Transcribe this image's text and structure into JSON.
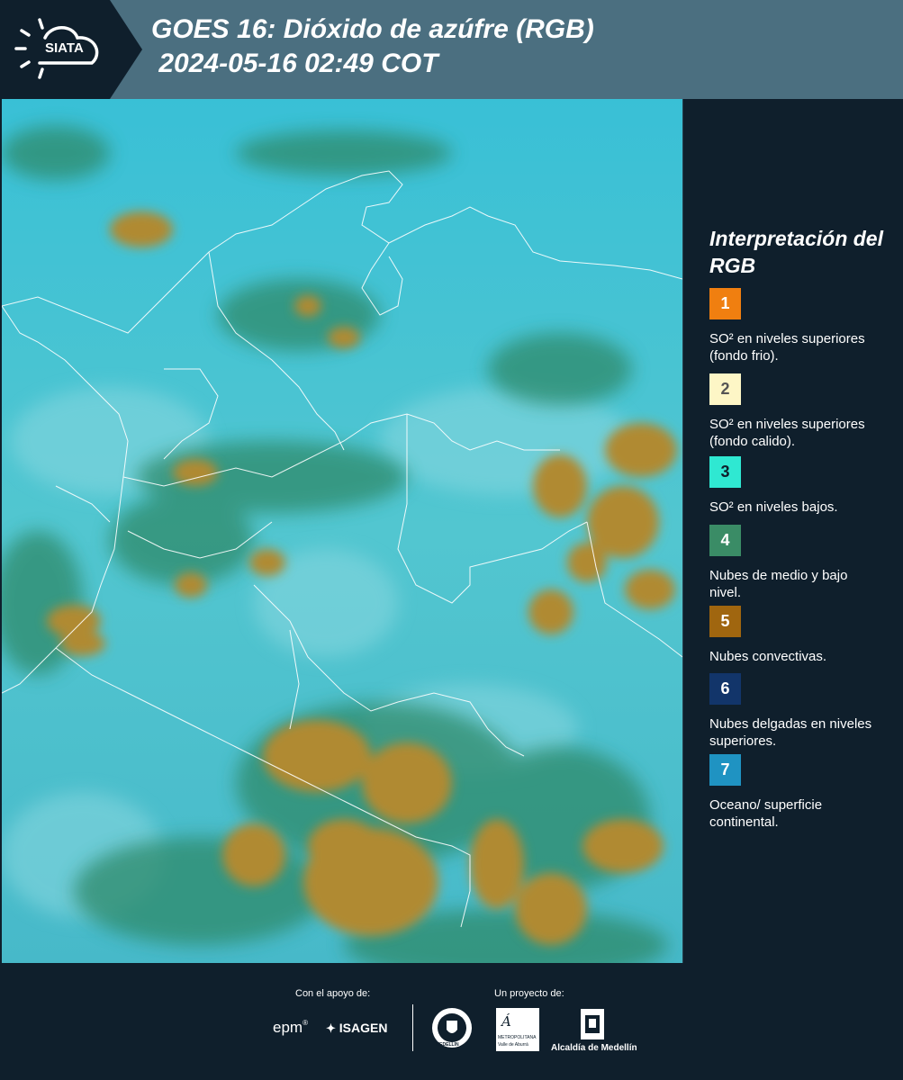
{
  "header": {
    "logo_text": "SIATA",
    "title_line1": "GOES 16: Dióxido de azúfre (RGB)",
    "title_line2": " 2024-05-16 02:49 COT"
  },
  "legend": {
    "title": "Interpretación del RGB",
    "items": [
      {
        "number": "1",
        "color": "#f07f10",
        "text": "SO² en niveles superiores (fondo frio)."
      },
      {
        "number": "2",
        "color": "#fdf6c6",
        "text": "SO² en niveles superiores (fondo calido)."
      },
      {
        "number": "3",
        "color": "#2fe8d2",
        "text": "SO² en niveles bajos."
      },
      {
        "number": "4",
        "color": "#3a8c66",
        "text": "Nubes de medio y bajo nivel."
      },
      {
        "number": "5",
        "color": "#a0660f",
        "text": "Nubes convectivas."
      },
      {
        "number": "6",
        "color": "#12356a",
        "text": "Nubes delgadas en niveles superiores."
      },
      {
        "number": "7",
        "color": "#1f93c2",
        "text": "Oceano/ superficie continental."
      }
    ]
  },
  "footer": {
    "support_label": "Con el apoyo de:",
    "project_label": "Un proyecto de:",
    "sponsor_epm": "epm",
    "sponsor_isagen": "ISAGEN",
    "sponsor_area_line1": "METROPOLITANA",
    "sponsor_area_line2": "Valle de Aburrá",
    "sponsor_alcaldia": "Alcaldía de Medellín",
    "seal_text": "MEDELLÍN"
  }
}
